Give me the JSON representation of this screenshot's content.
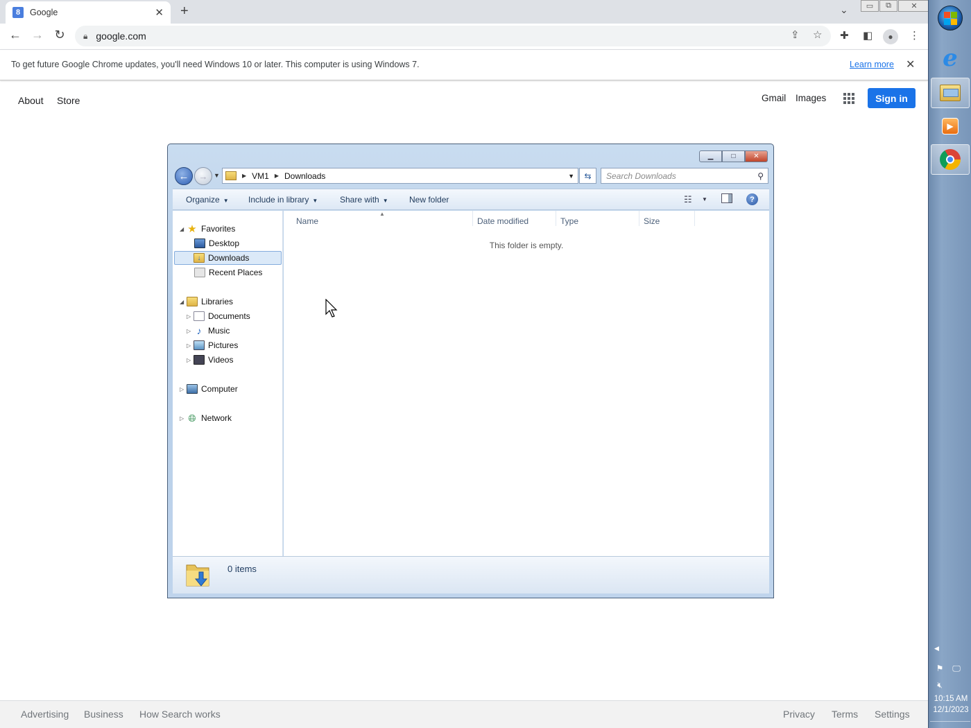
{
  "browser": {
    "tab": {
      "title": "Google",
      "favicon_letter": "8"
    },
    "address": "google.com",
    "infobar": {
      "message": "To get future Google Chrome updates, you'll need Windows 10 or later. This computer is using Windows 7.",
      "learn_more": "Learn more"
    }
  },
  "google": {
    "top_left": [
      "About",
      "Store"
    ],
    "top_right": {
      "gmail": "Gmail",
      "images": "Images",
      "sign_in": "Sign in"
    },
    "footer_left": [
      "Advertising",
      "Business",
      "How Search works"
    ],
    "footer_right": [
      "Privacy",
      "Terms",
      "Settings"
    ],
    "colors": {
      "sign_in_bg": "#1a73e8",
      "link": "#1a73e8"
    }
  },
  "explorer": {
    "breadcrumb": [
      "VM1",
      "Downloads"
    ],
    "search_placeholder": "Search Downloads",
    "commands": {
      "organize": "Organize",
      "include": "Include in library",
      "share": "Share with",
      "new_folder": "New folder"
    },
    "nav": {
      "favorites": "Favorites",
      "desktop": "Desktop",
      "downloads": "Downloads",
      "recent": "Recent Places",
      "libraries": "Libraries",
      "documents": "Documents",
      "music": "Music",
      "pictures": "Pictures",
      "videos": "Videos",
      "computer": "Computer",
      "network": "Network"
    },
    "columns": {
      "name": "Name",
      "date": "Date modified",
      "type": "Type",
      "size": "Size"
    },
    "empty_message": "This folder is empty.",
    "item_count": "0 items"
  },
  "taskbar": {
    "time": "10:15 AM",
    "date": "12/1/2023",
    "pinned": [
      "start-orb",
      "internet-explorer-icon",
      "windows-explorer-icon",
      "media-player-icon",
      "chrome-icon"
    ]
  }
}
